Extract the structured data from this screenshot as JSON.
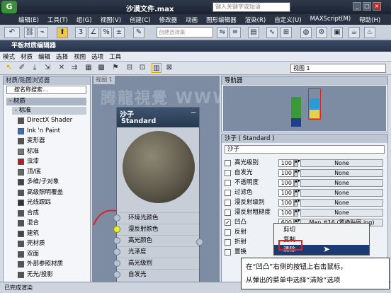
{
  "titlebar": {
    "logo": "G",
    "doc_title": "沙漠文件.max",
    "search_placeholder": "键入关键字或短语"
  },
  "menubar": [
    "编辑(E)",
    "工具(T)",
    "组(G)",
    "视图(V)",
    "创建(C)",
    "修改器",
    "动画",
    "图形编辑器",
    "渲染(R)",
    "自定义(U)",
    "MAXScript(M)",
    "帮助(H)"
  ],
  "toolbar": {
    "selection_set_placeholder": "创建选择集"
  },
  "editor": {
    "title": "平板材质编辑器",
    "menu": [
      "模式",
      "材质",
      "编辑",
      "选择",
      "视图",
      "选项",
      "工具"
    ],
    "view_select": "视图 1"
  },
  "browser": {
    "title": "材质/贴图浏览器",
    "search": "按名称搜索...",
    "category": "- 材质",
    "subcategory": "- 标准",
    "items": [
      {
        "label": "DirectX Shader",
        "color": "#555555"
      },
      {
        "label": "Ink 'n Paint",
        "color": "#3a6fb0"
      },
      {
        "label": "变形器",
        "color": "#555555"
      },
      {
        "label": "标准",
        "color": "#777777"
      },
      {
        "label": "虫漆",
        "color": "#b02020"
      },
      {
        "label": "顶/底",
        "color": "#666666"
      },
      {
        "label": "多维/子对象",
        "color": "#444444"
      },
      {
        "label": "高级照明覆盖",
        "color": "#555555"
      },
      {
        "label": "光线跟踪",
        "color": "#333333"
      },
      {
        "label": "合成",
        "color": "#555555"
      },
      {
        "label": "混合",
        "color": "#555555"
      },
      {
        "label": "建筑",
        "color": "#444444"
      },
      {
        "label": "壳材质",
        "color": "#555555"
      },
      {
        "label": "双面",
        "color": "#555555"
      },
      {
        "label": "外部参照材质",
        "color": "#555555"
      },
      {
        "label": "无光/投影",
        "color": "#555555"
      }
    ]
  },
  "view": {
    "tab": "视图 1",
    "node": {
      "name": "沙子",
      "type": "Standard",
      "slots": [
        "环境光颜色",
        "漫反射颜色",
        "高光颜色",
        "光泽度",
        "高光级别",
        "自发光"
      ]
    }
  },
  "navigator": {
    "title": "导航器"
  },
  "params": {
    "title": "沙子 ( Standard )",
    "name": "沙子",
    "rows": [
      {
        "label": "高光级别",
        "value": "100",
        "map": "None",
        "checked": false
      },
      {
        "label": "自发光",
        "value": "100",
        "map": "None",
        "checked": false
      },
      {
        "label": "不透明度",
        "value": "100",
        "map": "None",
        "checked": false
      },
      {
        "label": "过滤色",
        "value": "100",
        "map": "None",
        "checked": false
      },
      {
        "label": "漫反射级别",
        "value": "100",
        "map": "None",
        "checked": false
      },
      {
        "label": "漫反射粗糙度",
        "value": "100",
        "map": "None",
        "checked": false
      },
      {
        "label": "凹凸",
        "value": "600",
        "map": "Map #16 (置换贴图.jpg)",
        "checked": true
      },
      {
        "label": "反射",
        "value": "",
        "map": "",
        "checked": false
      },
      {
        "label": "折射",
        "value": "",
        "map": "",
        "checked": false
      },
      {
        "label": "置换",
        "value": "",
        "map": "",
        "checked": false
      }
    ]
  },
  "context_menu": {
    "items": [
      "剪切",
      "复制",
      "清除"
    ]
  },
  "status": "已完成渲染",
  "caption": {
    "line1": "在“凹凸”右侧的按钮上右击鼠标，",
    "line2": "从弹出的菜单中选择“清除”选项"
  },
  "watermark": "腾龍視覺 WWW.TLXI.NET"
}
